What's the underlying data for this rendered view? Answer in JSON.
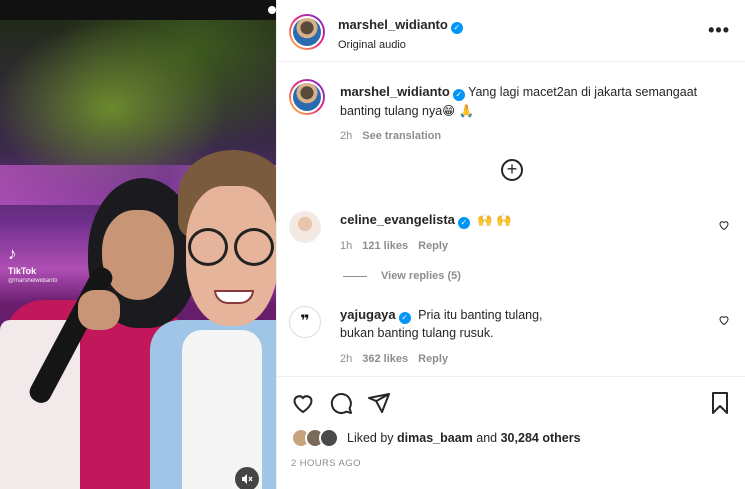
{
  "media": {
    "watermark_brand": "TikTok",
    "watermark_handle": "@marshelwidianto",
    "mute_icon": "speaker-muted-icon"
  },
  "header": {
    "username": "marshel_widianto",
    "subtitle": "Original audio",
    "more_icon": "more-horizontal-icon",
    "more_glyph": "•••"
  },
  "caption": {
    "username": "marshel_widianto",
    "text": "Yang lagi macet2an di jakarta semangaat banting tulang nya😁 🙏",
    "time": "2h",
    "translate": "See translation"
  },
  "load_more": {
    "icon": "plus-circle-icon",
    "glyph": "+"
  },
  "comments": [
    {
      "username": "celine_evangelista",
      "text": "🙌 🙌",
      "time": "1h",
      "likes": "121 likes",
      "reply": "Reply"
    },
    {
      "username": "yajugaya",
      "text": "Pria itu banting tulang,\nbukan banting tulang rusuk.",
      "time": "2h",
      "likes": "362 likes",
      "reply": "Reply"
    }
  ],
  "view_replies": "View replies (5)",
  "actions": {
    "like_icon": "heart-icon",
    "comment_icon": "comment-icon",
    "share_icon": "paper-plane-icon",
    "save_icon": "bookmark-icon"
  },
  "likes": {
    "prefix": "Liked by",
    "user": "dimas_baam",
    "middle": "and",
    "count": "30,284 others"
  },
  "timestamp": "2 HOURS AGO",
  "colors": {
    "verified": "#0095f6",
    "muted_text": "#8e8e8e",
    "text": "#262626"
  }
}
